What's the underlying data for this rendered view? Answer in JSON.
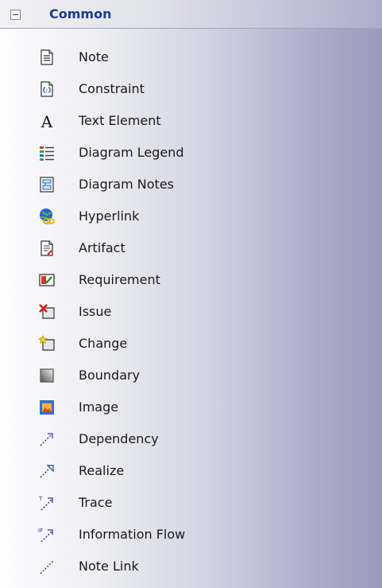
{
  "toolbox": {
    "group": {
      "title": "Common",
      "expanded": true,
      "items": [
        {
          "label": "Note",
          "icon": "note-icon"
        },
        {
          "label": "Constraint",
          "icon": "constraint-icon"
        },
        {
          "label": "Text Element",
          "icon": "text-element-icon"
        },
        {
          "label": "Diagram Legend",
          "icon": "diagram-legend-icon"
        },
        {
          "label": "Diagram Notes",
          "icon": "diagram-notes-icon"
        },
        {
          "label": "Hyperlink",
          "icon": "hyperlink-icon"
        },
        {
          "label": "Artifact",
          "icon": "artifact-icon"
        },
        {
          "label": "Requirement",
          "icon": "requirement-icon"
        },
        {
          "label": "Issue",
          "icon": "issue-icon"
        },
        {
          "label": "Change",
          "icon": "change-icon"
        },
        {
          "label": "Boundary",
          "icon": "boundary-icon"
        },
        {
          "label": "Image",
          "icon": "image-icon"
        },
        {
          "label": "Dependency",
          "icon": "dependency-icon"
        },
        {
          "label": "Realize",
          "icon": "realize-icon"
        },
        {
          "label": "Trace",
          "icon": "trace-icon"
        },
        {
          "label": "Information Flow",
          "icon": "information-flow-icon"
        },
        {
          "label": "Note Link",
          "icon": "note-link-icon"
        }
      ]
    }
  }
}
